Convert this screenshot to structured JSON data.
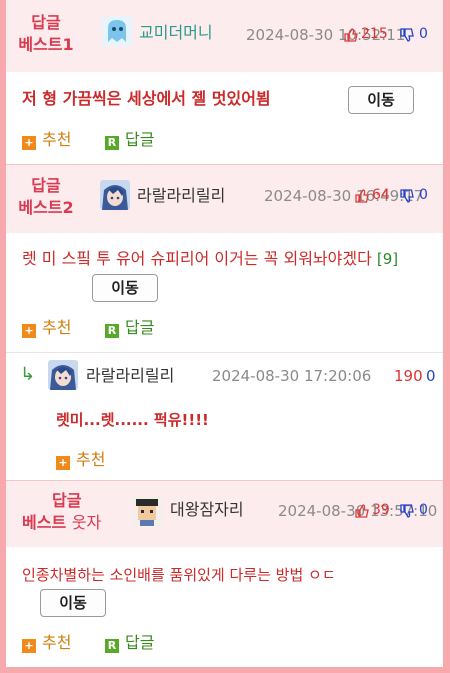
{
  "colors": {
    "background": "#f7a9ad",
    "header": "#fdeced",
    "accent": "#d83a50",
    "content": "#cc2a2a",
    "recommend": "#f08a1c",
    "reply": "#5aa82a"
  },
  "posts": [
    {
      "badge_line1": "답글",
      "badge_line2": "베스트1",
      "avatar_icon": "ghost-avatar-icon",
      "nick": "교미더머니",
      "date": "2024-08-30 10:52:11",
      "likes": "215",
      "dislikes": "0",
      "content": "저 형 가끔씩은 세상에서 젤 멋있어뵘",
      "move_label": "이동",
      "recommend_label": "추천",
      "reply_label": "답글"
    },
    {
      "badge_line1": "답글",
      "badge_line2": "베스트2",
      "avatar_icon": "anime-avatar-icon",
      "nick": "라랄라리릴리",
      "date": "2024-08-30 16:49:17",
      "likes": "64",
      "dislikes": "0",
      "content": "렛 미 스핔 투 유어 슈피리어 이거는 꼭 외워놔야겠다",
      "comment_count": "[9]",
      "move_label": "이동",
      "recommend_label": "추천",
      "reply_label": "답글"
    },
    {
      "nick": "라랄라리릴리",
      "avatar_icon": "anime-avatar-icon",
      "date": "2024-08-30 17:20:06",
      "likes": "190",
      "dislikes": "0",
      "content": "렛미...렛...... 퍽유!!!!",
      "recommend_label": "추천"
    },
    {
      "badge_line1": "답글",
      "badge_line2a": "베스트",
      "badge_line2b": "웃자",
      "avatar_icon": "pixel-avatar-icon",
      "nick": "대왕잠자리",
      "date": "2024-08-30 13:57:10",
      "likes": "39",
      "dislikes": "0",
      "content": "인종차별하는 소인배를 품위있게 다루는 방법 ㅇㄷ",
      "move_label": "이동",
      "recommend_label": "추천",
      "reply_label": "답글"
    }
  ]
}
